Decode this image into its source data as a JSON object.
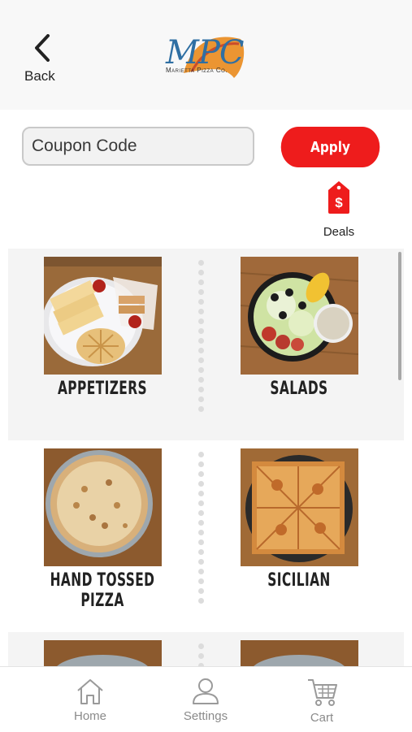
{
  "header": {
    "back_label": "Back",
    "logo_text": "MPC",
    "logo_subtext": "Marietta Pizza Co."
  },
  "coupon": {
    "placeholder": "Coupon Code",
    "apply_label": "Apply"
  },
  "deals": {
    "label": "Deals",
    "icon": "price-tag-icon"
  },
  "categories": [
    {
      "label": "APPETIZERS"
    },
    {
      "label": "SALADS"
    },
    {
      "label": "HAND TOSSED PIZZA"
    },
    {
      "label": "SICILIAN"
    }
  ],
  "tabbar": {
    "home_label": "Home",
    "settings_label": "Settings",
    "cart_label": "Cart"
  },
  "colors": {
    "accent": "#ee1c1c",
    "tab_text": "#8a8a8a"
  }
}
